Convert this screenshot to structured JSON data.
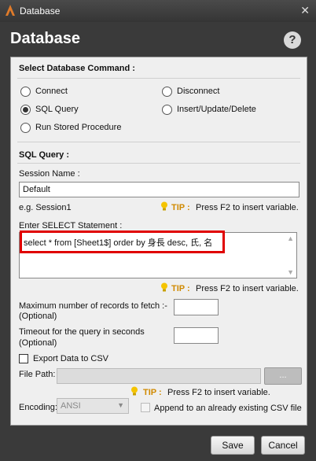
{
  "window": {
    "title": "Database",
    "close_glyph": "✕"
  },
  "header": {
    "heading": "Database",
    "help_glyph": "?"
  },
  "command": {
    "section_title": "Select Database Command :",
    "options": {
      "connect": "Connect",
      "disconnect": "Disconnect",
      "sql_query": "SQL Query",
      "insert_update_delete": "Insert/Update/Delete",
      "run_stored_procedure": "Run Stored Procedure"
    },
    "selected": "SQL Query"
  },
  "sql_query": {
    "section_title": "SQL Query :",
    "session_label": "Session Name :",
    "session_value": "Default",
    "session_hint": "e.g. Session1",
    "tip_label": "TIP :",
    "tip_text": "Press F2 to insert variable.",
    "select_label": "Enter SELECT Statement :",
    "select_value": "select * from [Sheet1$] order by 身長 desc, 氏, 名",
    "max_records_label_1": "Maximum number of records to fetch :-",
    "max_records_label_2": "(Optional)",
    "max_records_value": "",
    "timeout_label_1": "Timeout for the query in seconds",
    "timeout_label_2": "(Optional)",
    "timeout_value": ""
  },
  "export": {
    "checkbox_label": "Export Data to CSV",
    "checked": false,
    "file_path_label": "File Path:",
    "file_path_value": "",
    "browse_label": "...",
    "encoding_label": "Encoding:",
    "encoding_value": "ANSI",
    "append_label": "Append to an already existing CSV file"
  },
  "buttons": {
    "save": "Save",
    "cancel": "Cancel"
  },
  "colors": {
    "tip": "#d08a00",
    "highlight": "#e00000",
    "background": "#3a3a3a"
  },
  "icons": {
    "tip": "lightbulb-icon",
    "app": "app-logo-icon",
    "help": "help-icon"
  }
}
